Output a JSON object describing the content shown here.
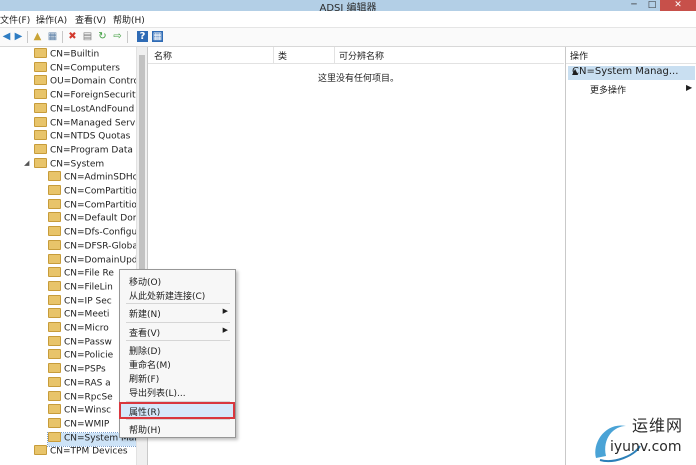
{
  "window": {
    "title": "ADSI 编辑器",
    "minimize": "─",
    "maximize": "□",
    "close": "✕"
  },
  "menu": [
    "文件(F)",
    "操作(A)",
    "查看(V)",
    "帮助(H)"
  ],
  "toolbar": {
    "icons": [
      "back-icon",
      "forward-icon",
      "up-folder-icon",
      "show-hide-tree-icon",
      "delete-icon",
      "properties-icon",
      "refresh-icon",
      "export-icon",
      "help-icon",
      "view-icon"
    ]
  },
  "tree": {
    "items": [
      {
        "label": "CN=Builtin",
        "level": 0
      },
      {
        "label": "CN=Computers",
        "level": 0
      },
      {
        "label": "OU=Domain Controll",
        "level": 0
      },
      {
        "label": "CN=ForeignSecurityP",
        "level": 0
      },
      {
        "label": "CN=LostAndFound",
        "level": 0
      },
      {
        "label": "CN=Managed Servic",
        "level": 0
      },
      {
        "label": "CN=NTDS Quotas",
        "level": 0
      },
      {
        "label": "CN=Program Data",
        "level": 0
      },
      {
        "label": "CN=System",
        "level": 0,
        "expanded": true
      },
      {
        "label": "CN=AdminSDHolc",
        "level": 1
      },
      {
        "label": "CN=ComPartitions",
        "level": 1
      },
      {
        "label": "CN=ComPartitionS",
        "level": 1
      },
      {
        "label": "CN=Default Doma",
        "level": 1
      },
      {
        "label": "CN=Dfs-Configura",
        "level": 1
      },
      {
        "label": "CN=DFSR-GlobalS",
        "level": 1
      },
      {
        "label": "CN=DomainUpda",
        "level": 1
      },
      {
        "label": "CN=File Re",
        "level": 1
      },
      {
        "label": "CN=FileLin",
        "level": 1
      },
      {
        "label": "CN=IP Sec",
        "level": 1
      },
      {
        "label": "CN=Meeti",
        "level": 1
      },
      {
        "label": "CN=Micro",
        "level": 1
      },
      {
        "label": "CN=Passw",
        "level": 1
      },
      {
        "label": "CN=Policie",
        "level": 1
      },
      {
        "label": "CN=PSPs",
        "level": 1
      },
      {
        "label": "CN=RAS a",
        "level": 1
      },
      {
        "label": "CN=RpcSe",
        "level": 1
      },
      {
        "label": "CN=Winsc",
        "level": 1
      },
      {
        "label": "CN=WMIP",
        "level": 1
      },
      {
        "label": "CN=System Mana",
        "level": 1,
        "selected": true
      },
      {
        "label": "CN=TPM Devices",
        "level": 0
      }
    ]
  },
  "list": {
    "columns": [
      "名称",
      "类",
      "可分辨名称"
    ],
    "empty_message": "这里没有任何项目。"
  },
  "actions": {
    "header": "操作",
    "section": "CN=System Manag...",
    "more": "更多操作"
  },
  "context_menu": {
    "items": [
      {
        "label": "移动(O)"
      },
      {
        "label": "从此处新建连接(C)"
      },
      {
        "separator": true
      },
      {
        "label": "新建(N)",
        "submenu": true
      },
      {
        "separator": true
      },
      {
        "label": "查看(V)",
        "submenu": true
      },
      {
        "separator": true
      },
      {
        "label": "删除(D)"
      },
      {
        "label": "重命名(M)"
      },
      {
        "label": "刷新(F)"
      },
      {
        "label": "导出列表(L)..."
      },
      {
        "separator": true
      },
      {
        "label": "属性(R)",
        "highlighted": true
      },
      {
        "separator": true
      },
      {
        "label": "帮助(H)"
      }
    ]
  },
  "watermark": {
    "cn": "运维网",
    "en": "iyunv.com"
  },
  "colors": {
    "titlebar": "#b3cfe6",
    "selection": "#cde3f7",
    "highlight_border": "#d9373e",
    "actions_section": "#c9dff1"
  }
}
